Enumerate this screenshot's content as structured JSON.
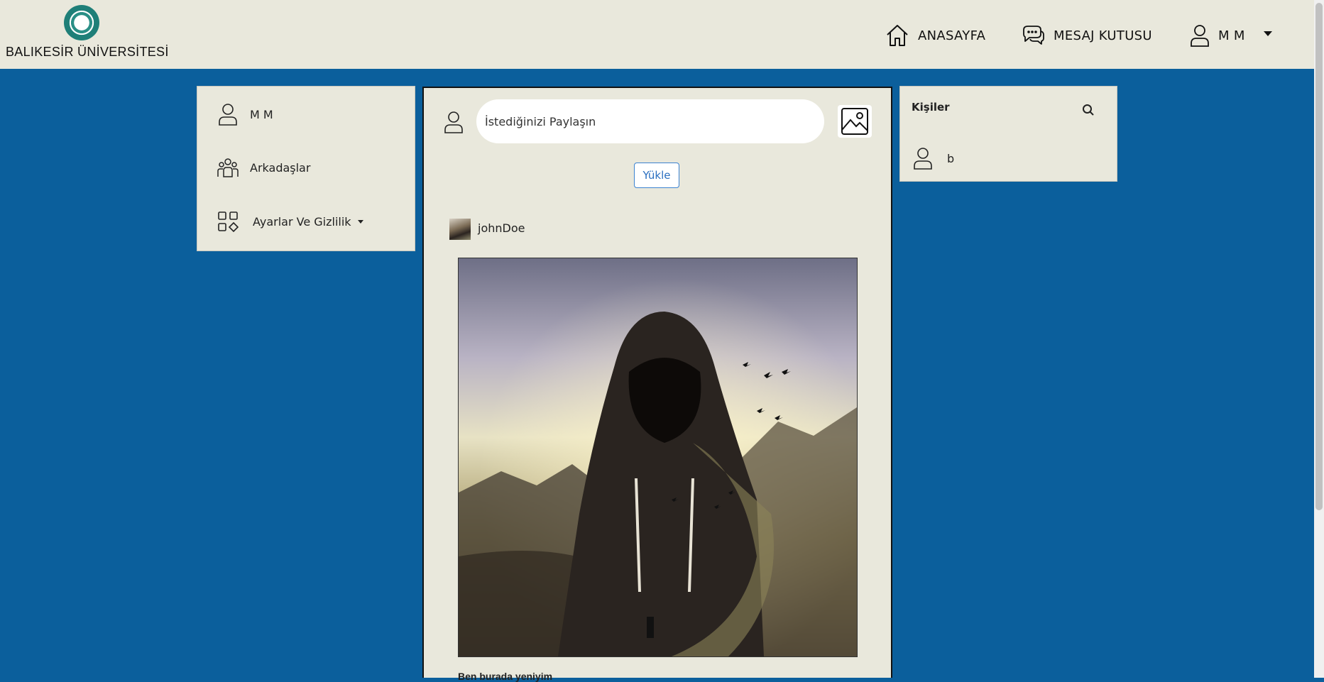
{
  "header": {
    "brand": "BALIKESİR ÜNİVERSİTESİ",
    "nav": {
      "home": "ANASAYFA",
      "messages": "MESAJ KUTUSU",
      "user": "M M"
    }
  },
  "sidebar": {
    "profile_name": "M M",
    "friends": "Arkadaşlar",
    "settings": "Ayarlar Ve Gizlilik"
  },
  "composer": {
    "placeholder": "İstediğinizi Paylaşın",
    "upload_label": "Yükle"
  },
  "post": {
    "author": "johnDoe",
    "caption": "Ben burada yeniyim"
  },
  "contacts": {
    "title": "Kişiler",
    "items": [
      {
        "name": "b"
      }
    ]
  },
  "icons": {
    "home": "home-icon",
    "messages": "chat-bubbles-icon",
    "user": "user-icon",
    "friends": "group-icon",
    "settings": "grid-shapes-icon",
    "image": "image-icon",
    "search": "search-icon"
  },
  "colors": {
    "page_background": "#0b5f9c",
    "panel_background": "#e9e8dc",
    "upload_button": "#2a6fc0"
  }
}
